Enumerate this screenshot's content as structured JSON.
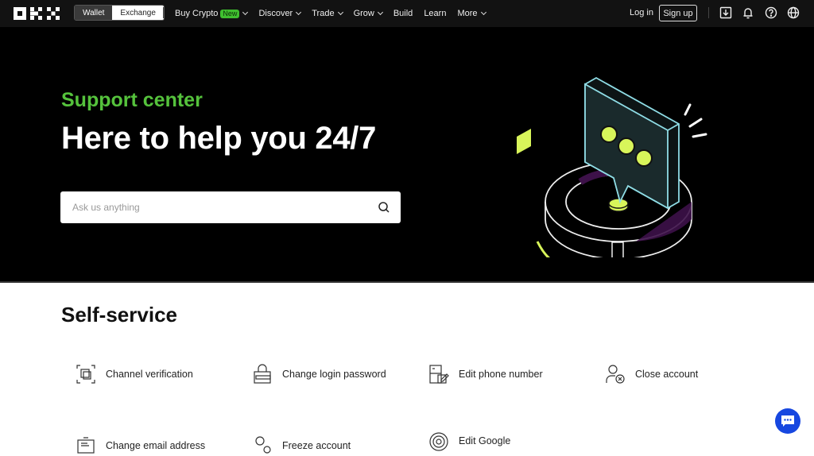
{
  "nav": {
    "logo": "OKX",
    "toggle": {
      "wallet": "Wallet",
      "exchange": "Exchange",
      "selected": "Exchange"
    },
    "links": [
      {
        "label": "Buy Crypto",
        "badge": "New",
        "dropdown": true
      },
      {
        "label": "Discover",
        "dropdown": true
      },
      {
        "label": "Trade",
        "dropdown": true
      },
      {
        "label": "Grow",
        "dropdown": true
      },
      {
        "label": "Build",
        "dropdown": false
      },
      {
        "label": "Learn",
        "dropdown": false
      },
      {
        "label": "More",
        "dropdown": true
      }
    ],
    "login": "Log in",
    "signup": "Sign up",
    "icons": [
      "download-icon",
      "bell-icon",
      "help-icon",
      "globe-icon"
    ]
  },
  "hero": {
    "subtitle": "Support center",
    "title": "Here to help you 24/7",
    "search_placeholder": "Ask us anything",
    "search_value": ""
  },
  "self_service": {
    "title": "Self-service",
    "items": [
      {
        "label": "Channel verification",
        "icon": "channel-verification-icon"
      },
      {
        "label": "Change login password",
        "icon": "lock-icon"
      },
      {
        "label": "Edit phone number",
        "icon": "phone-edit-icon"
      },
      {
        "label": "Close account",
        "icon": "user-remove-icon"
      },
      {
        "label": "Change email address",
        "icon": "email-icon"
      },
      {
        "label": "Freeze account",
        "icon": "freeze-user-icon"
      },
      {
        "label": "Edit Google",
        "icon": "google-auth-icon"
      }
    ]
  },
  "colors": {
    "accent_green": "#55c23c",
    "badge_green": "#3fbf2f",
    "lime": "#d8f55a",
    "cyan_outline": "#8fdde6",
    "purple": "#3d1149",
    "chat_blue": "#1747e0"
  },
  "chat_button": {
    "icon": "chat-icon"
  }
}
